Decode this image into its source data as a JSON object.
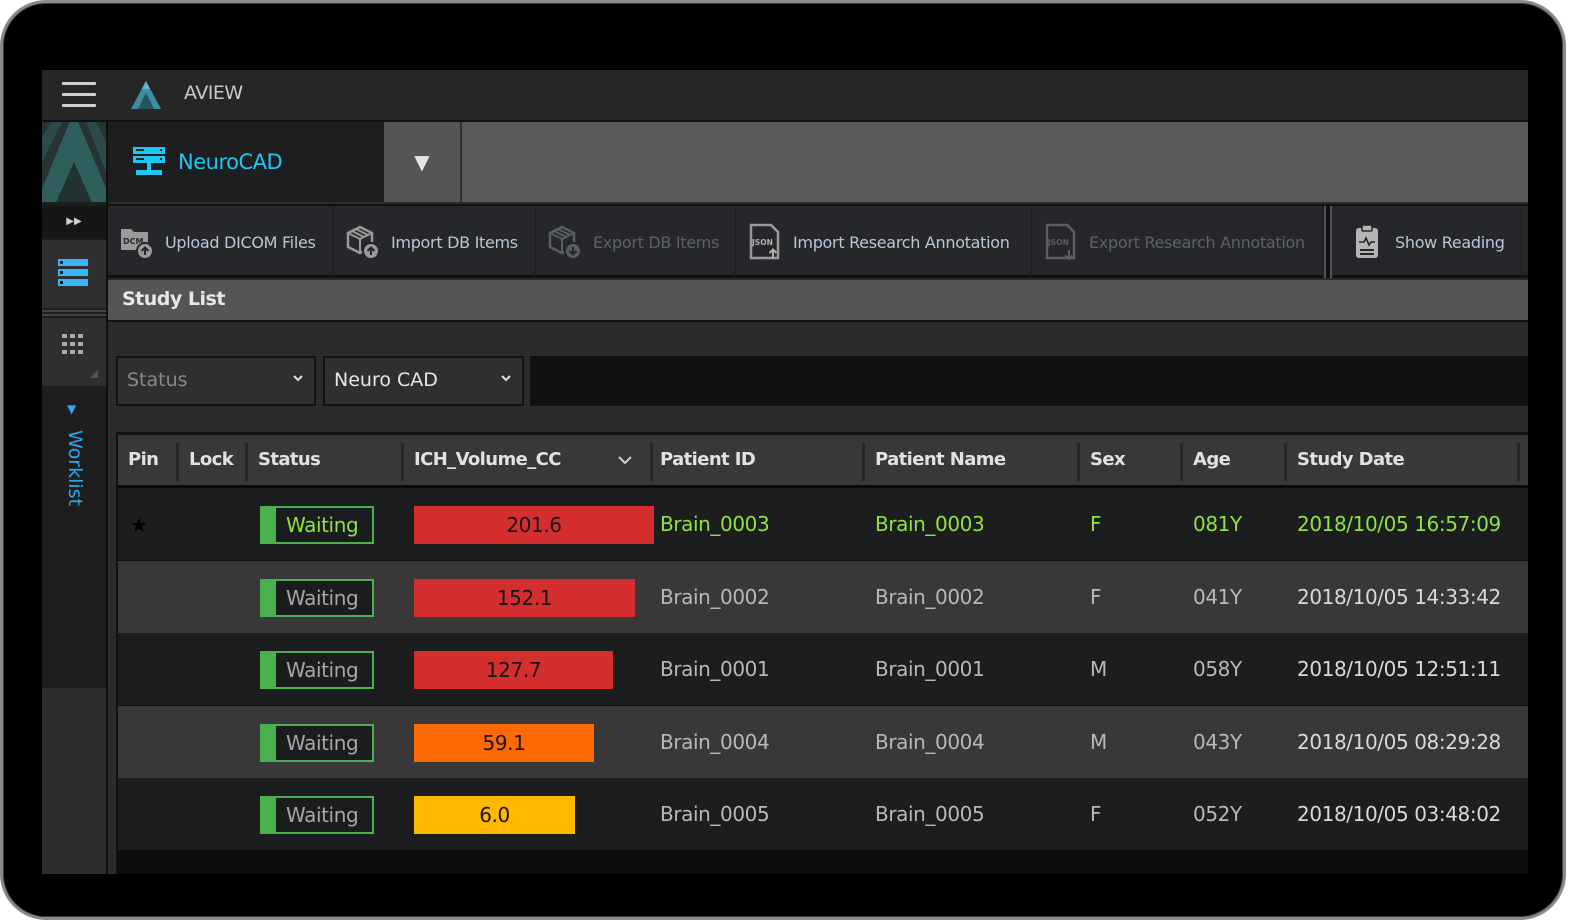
{
  "app": {
    "title": "AVIEW"
  },
  "sidebar": {
    "expand_icon": "double-chevron-right",
    "items": [
      {
        "name": "study-list",
        "icon": "server-list-icon",
        "active": true
      },
      {
        "name": "apps",
        "icon": "grid-icon",
        "active": false
      }
    ],
    "worklist_label": "Worklist"
  },
  "module": {
    "label": "NeuroCAD",
    "icon": "network-server-icon",
    "dropdown_glyph": "▼"
  },
  "toolbar": {
    "buttons": [
      {
        "label": "Upload DICOM Files",
        "icon": "dicom-upload-icon",
        "enabled": true
      },
      {
        "label": "Import DB Items",
        "icon": "db-import-icon",
        "enabled": true
      },
      {
        "label": "Export DB Items",
        "icon": "db-export-icon",
        "enabled": false
      },
      {
        "label": "Import Research Annotation",
        "icon": "json-import-icon",
        "enabled": true
      },
      {
        "label": "Export Research Annotation",
        "icon": "json-export-icon",
        "enabled": false
      },
      {
        "label": "Show Reading",
        "icon": "clipboard-pulse-icon",
        "enabled": true
      }
    ]
  },
  "study_list": {
    "title": "Study List",
    "filters": {
      "status": {
        "value": "",
        "placeholder": "Status"
      },
      "algorithm": {
        "value": "Neuro CAD"
      },
      "search": {
        "value": "",
        "placeholder": ""
      }
    },
    "columns": [
      "Pin",
      "Lock",
      "Status",
      "ICH_Volume_CC",
      "Patient ID",
      "Patient Name",
      "Sex",
      "Age",
      "Study Date"
    ],
    "sort_column": "ICH_Volume_CC",
    "sort_direction": "descending",
    "rows": [
      {
        "pinned": true,
        "pin_glyph": "★",
        "locked": false,
        "status": "Waiting",
        "ich_volume": "201.6",
        "volume_level": 1.0,
        "volume_color": "#d42e2e",
        "patient_id": "Brain_0003",
        "patient_name": "Brain_0003",
        "sex": "F",
        "age": "081Y",
        "study_date": "2018/10/05 16:57:09",
        "highlighted": true
      },
      {
        "pinned": false,
        "pin_glyph": "",
        "locked": false,
        "status": "Waiting",
        "ich_volume": "152.1",
        "volume_level": 0.92,
        "volume_color": "#d42e2e",
        "patient_id": "Brain_0002",
        "patient_name": "Brain_0002",
        "sex": "F",
        "age": "041Y",
        "study_date": "2018/10/05 14:33:42",
        "highlighted": false
      },
      {
        "pinned": false,
        "pin_glyph": "",
        "locked": false,
        "status": "Waiting",
        "ich_volume": "127.7",
        "volume_level": 0.83,
        "volume_color": "#d42e2e",
        "patient_id": "Brain_0001",
        "patient_name": "Brain_0001",
        "sex": "M",
        "age": "058Y",
        "study_date": "2018/10/05 12:51:11",
        "highlighted": false
      },
      {
        "pinned": false,
        "pin_glyph": "",
        "locked": false,
        "status": "Waiting",
        "ich_volume": "59.1",
        "volume_level": 0.75,
        "volume_color": "#ff6a00",
        "patient_id": "Brain_0004",
        "patient_name": "Brain_0004",
        "sex": "M",
        "age": "043Y",
        "study_date": "2018/10/05 08:29:28",
        "highlighted": false
      },
      {
        "pinned": false,
        "pin_glyph": "",
        "locked": false,
        "status": "Waiting",
        "ich_volume": "6.0",
        "volume_level": 0.67,
        "volume_color": "#ffb700",
        "patient_id": "Brain_0005",
        "patient_name": "Brain_0005",
        "sex": "F",
        "age": "052Y",
        "study_date": "2018/10/05 03:48:02",
        "highlighted": false
      }
    ]
  },
  "colors": {
    "accent": "#1ec7f2",
    "worklist_blue": "#2aa5ee",
    "highlight_green": "#8fe33f",
    "status_green": "#4bb04e"
  }
}
